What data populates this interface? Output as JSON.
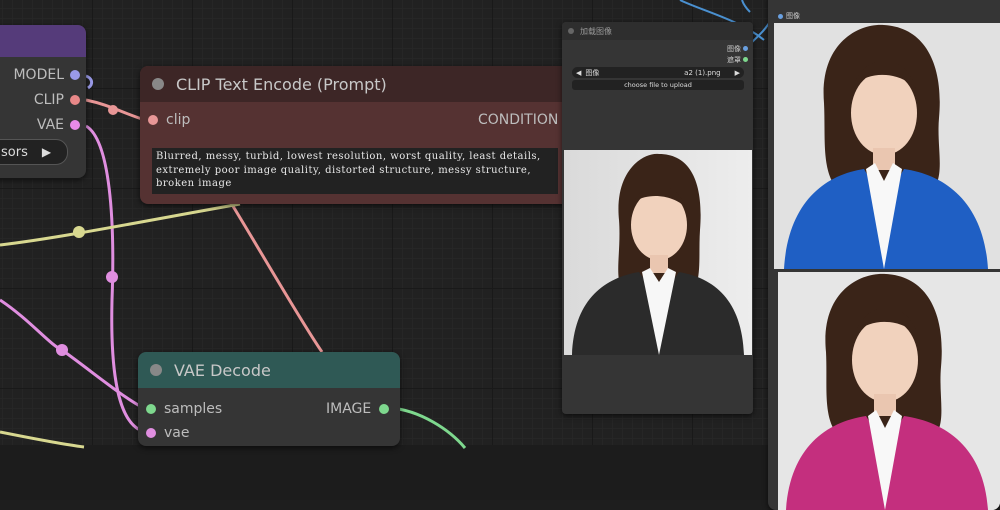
{
  "checkpoint": {
    "outputs": [
      "MODEL",
      "CLIP",
      "VAE"
    ],
    "button_label": "sors",
    "colors": {
      "model": "#9a9ae8",
      "clip": "#e88888",
      "vae": "#e88ae8"
    }
  },
  "clip_encode": {
    "title": "CLIP Text Encode (Prompt)",
    "input": "clip",
    "output": "CONDITION",
    "prompt": "Blurred, messy, turbid, lowest resolution, worst quality, least details, extremely poor image quality, distorted structure, messy structure, broken image"
  },
  "vae_decode": {
    "title": "VAE Decode",
    "inputs": [
      "samples",
      "vae"
    ],
    "output": "IMAGE"
  },
  "load_image": {
    "title": "加载图像",
    "outputs": [
      "图像",
      "遮罩"
    ],
    "combo_label": "图像",
    "combo_value": "a2 (1).png",
    "upload_label": "choose file to upload"
  },
  "preview": {
    "input_label": "图像"
  },
  "wire_colors": {
    "clip": "#e89696",
    "vae": "#e08ee0",
    "conditioning": "#d8d890",
    "image": "#7ed88e",
    "blue": "#4a90d0"
  }
}
